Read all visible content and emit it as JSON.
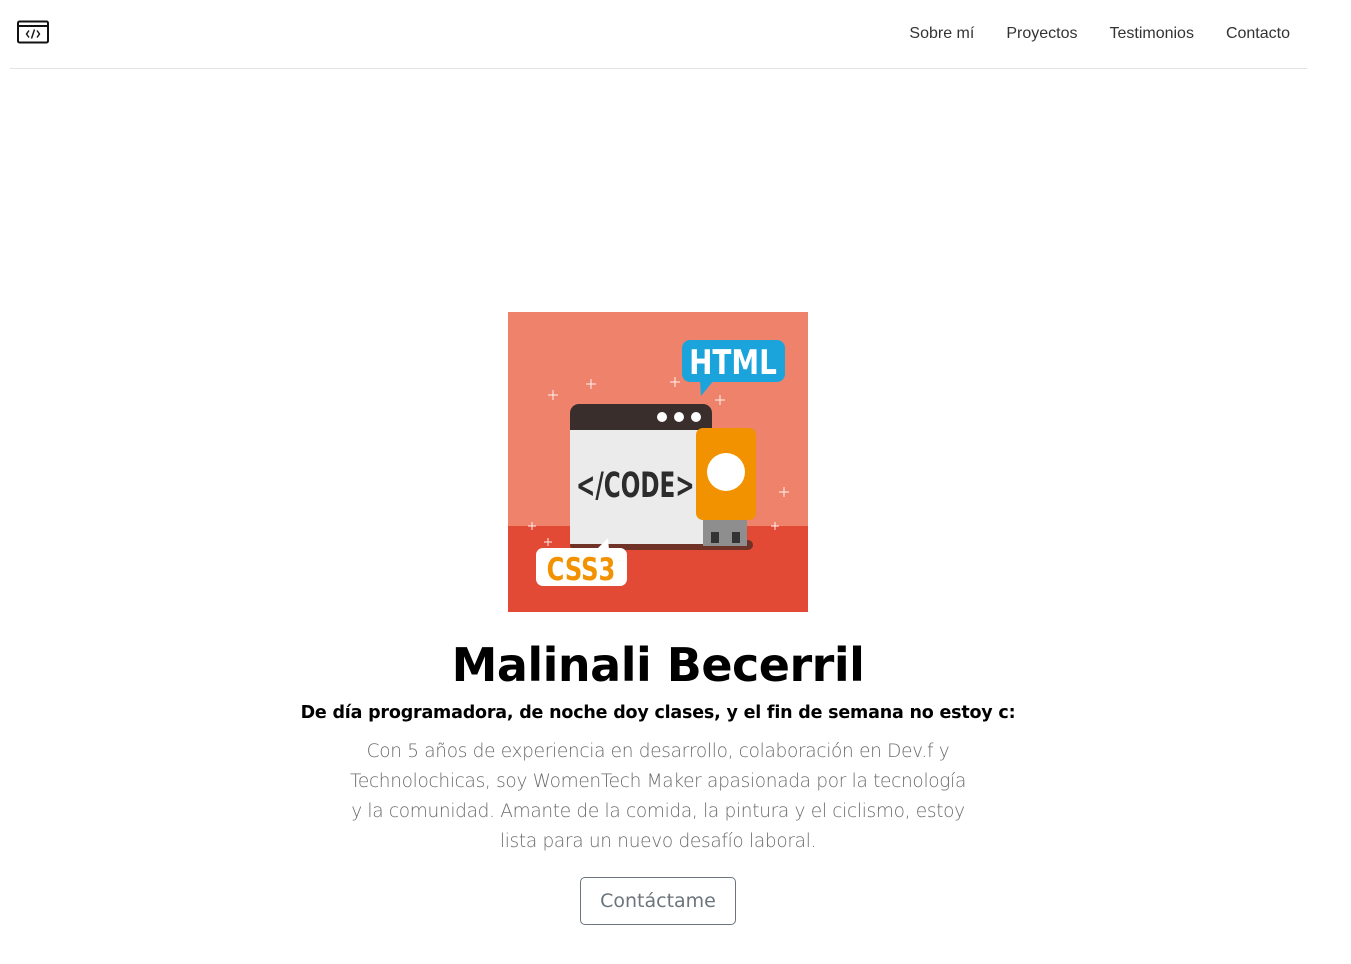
{
  "nav": {
    "logo_icon": "code-window-icon",
    "links": [
      "Sobre mí",
      "Proyectos",
      "Testimonios",
      "Contacto"
    ]
  },
  "hero": {
    "image": {
      "icon": "code-illustration",
      "html_label": "HTML",
      "code_label": "</CODE>",
      "css_label": "CSS3"
    },
    "name": "Malinali Becerril",
    "tagline": "De día programadora, de noche doy clases, y el fin de semana no estoy c:",
    "description": "Con 5 años de experiencia en desarrollo, colaboración en Dev.f y Technolochicas, soy WomenTech Maker apasionada por la tecnología y la comunidad. Amante de la comida, la pintura y el ciclismo, estoy lista para un nuevo desafío laboral.",
    "button_label": "Contáctame"
  },
  "colors": {
    "bg_top": "#ee826b",
    "bg_bottom": "#e34a36",
    "html_bubble": "#1ba4dc",
    "usb_orange": "#f39200",
    "css_text": "#f39200",
    "window_bar": "#3a2e2c",
    "window_body": "#ebebeb",
    "button_border": "#6c757d"
  }
}
